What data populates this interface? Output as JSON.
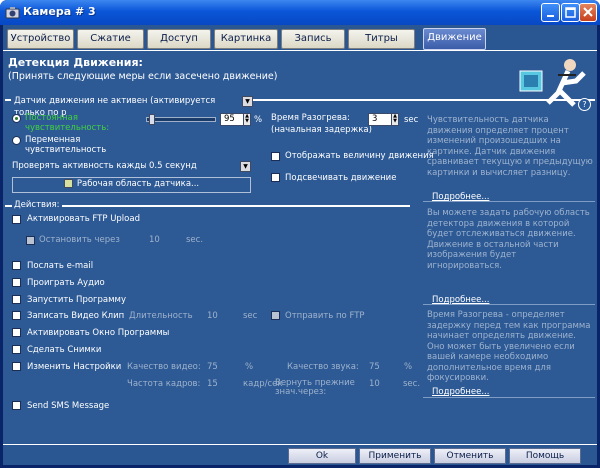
{
  "window": {
    "title": "Камера # 3"
  },
  "tabs": [
    "Устройство",
    "Сжатие",
    "Доступ",
    "Картинка",
    "Запись",
    "Титры",
    "Движение"
  ],
  "header": {
    "title": "Детекция Движения:",
    "subtitle": "(Принять следующие меры если засечено движение)"
  },
  "sensor": {
    "combo_value": "Датчик движения не активен (активируется только по р",
    "constant_sens": "Постоянная чувствительность:",
    "variable_sens": "Переменная чувствительность",
    "sens_value": "95",
    "percent": "%",
    "check_label": "Проверять активность каждые:",
    "check_value": "0.5 секунд",
    "area_button": "Рабочая область датчика...",
    "warmup_label": "Время Разогрева:",
    "warmup_sub": "(начальная задержка)",
    "warmup_value": "3",
    "sec": "sec",
    "show_value": "Отображать величину движения",
    "highlight": "Подсвечивать движение"
  },
  "actions": {
    "section_label": "Действия:",
    "ftp": "Активировать FTP Upload",
    "stop_after": "Остановить через",
    "stop_value": "10",
    "sec": "sec.",
    "email": "Послать e-mail",
    "audio": "Проиграть Аудио",
    "run_program": "Запустить Программу",
    "record_clip": "Записать Видео Клип",
    "duration": "Длительность",
    "duration_value": "10",
    "duration_unit": "sec",
    "send_ftp": "Отправить по FTP",
    "activate_window": "Активировать Окно Программы",
    "snapshots": "Сделать Снимки",
    "change_settings": "Изменить Настройки",
    "video_quality": "Качество видео:",
    "video_quality_value": "75",
    "pct1": "%",
    "sound_quality": "Качество звука:",
    "sound_quality_value": "75",
    "pct2": "%",
    "frame_rate": "Частота кадров:",
    "frame_rate_value": "15",
    "fps_unit": "кадр/сек",
    "restore": "Вернуть прежние знач.через:",
    "restore_value": "10",
    "restore_unit": "sec.",
    "sms": "Send SMS Message"
  },
  "help": {
    "text1": "Чувствительность датчика движения определяет процент изменений произошедших на картинке. Датчик движения сравнивает текущую и предыдущую картинки и вычисляет разницу.",
    "more1": "Подробнее...",
    "text2": "Вы можете задать рабочую область детектора движения в которой будет отслеживаться движение. Движение в остальной части изображения будет игнорироваться.",
    "more2": "Подробнее...",
    "text3": "Время Разогрева - определяет задержку перед тем как программа начинает определять движение. Оно может быть увеличено если вашей камере необходимо дополнительное время для фокусировки.",
    "more3": "Подробнее..."
  },
  "buttons": {
    "ok": "Ok",
    "apply": "Применить",
    "cancel": "Отменить",
    "help": "Помощь"
  }
}
